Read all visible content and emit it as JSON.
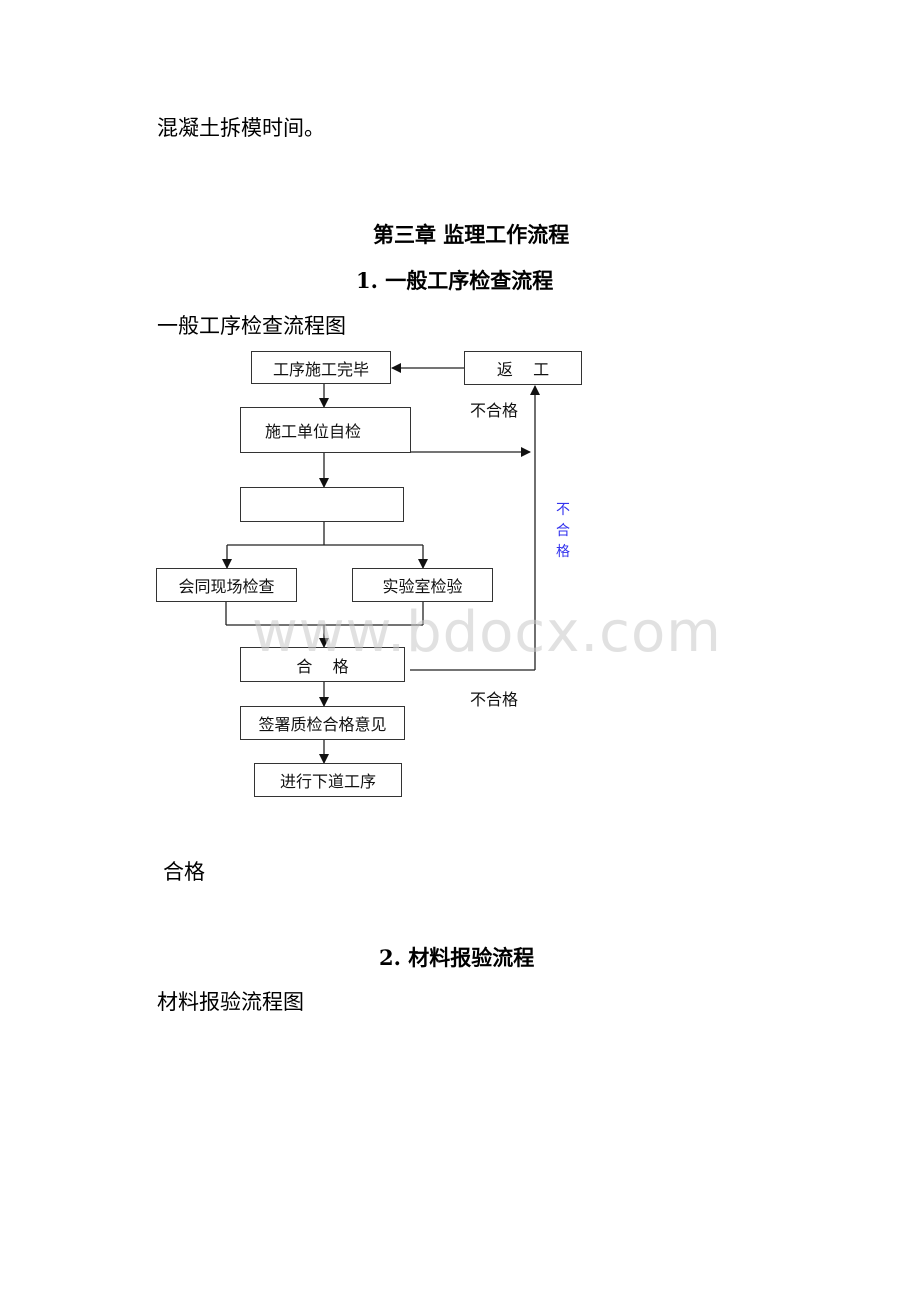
{
  "document": {
    "intro_text": "混凝土拆模时间。",
    "chapter_title": "第三章  监理工作流程",
    "section1": {
      "heading": "1. 一般工序检查流程",
      "figure_caption": "一般工序检查流程图",
      "flowchart": {
        "nodes": {
          "process_complete": "工序施工完毕",
          "rework": "返    工",
          "self_check": "施工单位自检",
          "blank_step": "",
          "site_inspection": "会同现场检查",
          "lab_test": "实验室检验",
          "qualified": "合    格",
          "sign_opinion": "签署质检合格意见",
          "next_process": "进行下道工序"
        },
        "labels": {
          "unqualified_top": "不合格",
          "unqualified_side": "不合格",
          "unqualified_bottom": "不合格"
        },
        "colors": {
          "side_label": "#3333ee",
          "line": "#222222"
        }
      },
      "trailing_text": "合格"
    },
    "section2": {
      "heading": "2. 材料报验流程",
      "figure_caption": "材料报验流程图"
    },
    "watermark": "www.bdocx.com"
  }
}
